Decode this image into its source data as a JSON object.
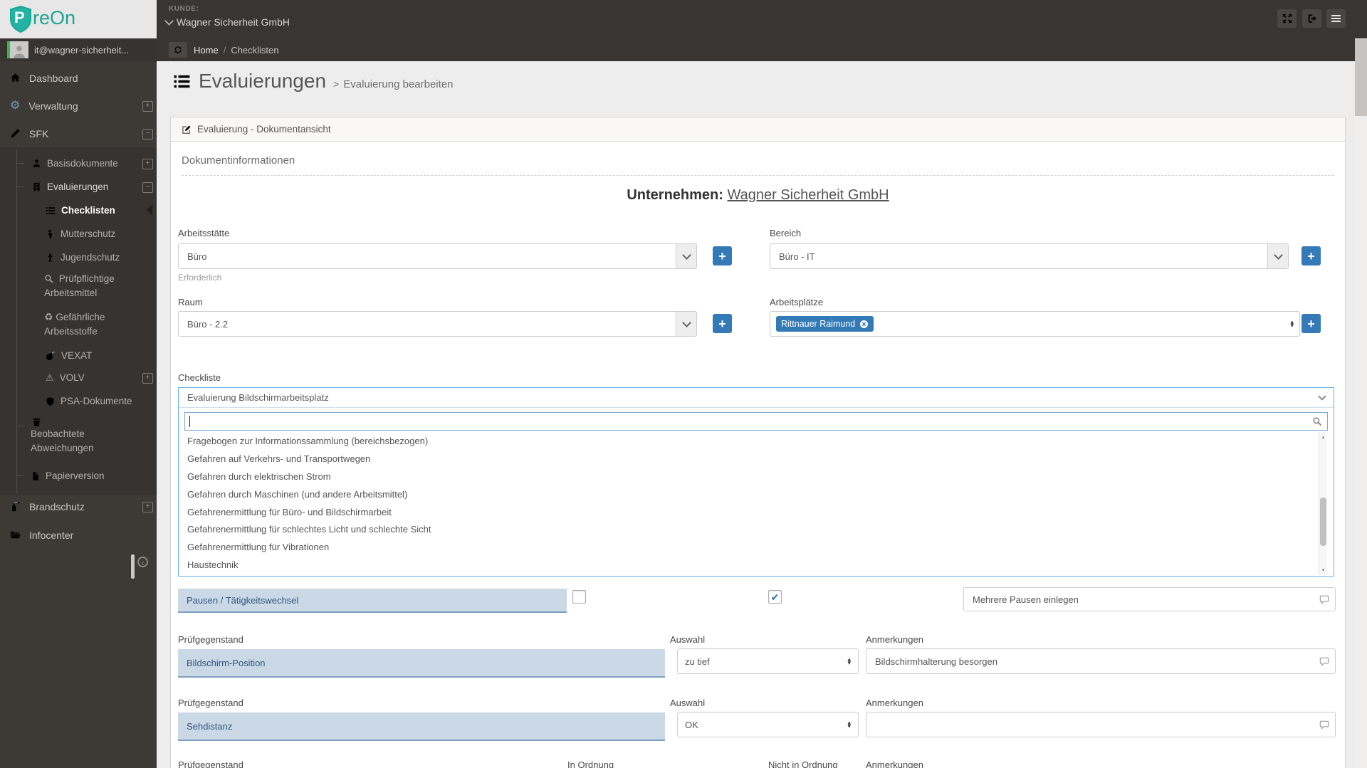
{
  "colors": {
    "accent_blue": "#337ab7",
    "brand_teal": "#23a393",
    "sidebar_bg": "#3a3633",
    "topbar_bg": "#393532",
    "highlight_row_bg": "#cbd9e7",
    "highlight_row_text": "#31567d",
    "focus_border": "#66afe9",
    "tag_green": "#3bb54a"
  },
  "brand": {
    "shield_letter": "P",
    "name_rest": "reOn"
  },
  "topbar": {
    "kunde_label": "KUNDE:",
    "kunde_value": "Wagner Sicherheit GmbH"
  },
  "user": {
    "email": "it@wagner-sicherheit..."
  },
  "breadcrumb": {
    "home": "Home",
    "separator": "/",
    "current": "Checklisten"
  },
  "sidebar": {
    "dashboard": "Dashboard",
    "verwaltung": "Verwaltung",
    "sfk": "SFK",
    "basisdokumente": "Basisdokumente",
    "evaluierungen": "Evaluierungen",
    "checklisten": "Checklisten",
    "mutterschutz": "Mutterschutz",
    "jugendschutz": "Jugendschutz",
    "pruefpflichtige": "Prüfpflichtige Arbeitsmittel",
    "gefaehrliche": "Gefährliche Arbeitsstoffe",
    "vexat": "VEXAT",
    "volv": "VOLV",
    "psa": "PSA-Dokumente",
    "beobachtete_line1": "Beobachtete",
    "beobachtete_line2": "Abweichungen",
    "papierversion": "Papierversion",
    "brandschutz": "Brandschutz",
    "infocenter": "Infocenter"
  },
  "page": {
    "title": "Evaluierungen",
    "title_separator": ">",
    "subtitle": "Evaluierung bearbeiten"
  },
  "panel": {
    "header": "Evaluierung - Dokumentansicht",
    "section": "Dokumentinformationen"
  },
  "company": {
    "label": "Unternehmen:",
    "name": "Wagner Sicherheit GmbH"
  },
  "form": {
    "arbeitsstaette": {
      "label": "Arbeitsstätte",
      "value": "Büro",
      "hint": "Erforderlich"
    },
    "bereich": {
      "label": "Bereich",
      "value": "Büro - IT"
    },
    "raum": {
      "label": "Raum",
      "value": "Büro - 2.2"
    },
    "arbeitsplaetze": {
      "label": "Arbeitsplätze",
      "tag": "Rittnauer Raimund"
    },
    "checkliste": {
      "label": "Checkliste",
      "selected": "Evaluierung Bildschirmarbeitsplatz",
      "search_value": "",
      "options": [
        "Fragebogen zur Informationssammlung (bereichsbezogen)",
        "Gefahren auf Verkehrs- und Transportwegen",
        "Gefahren durch elektrischen Strom",
        "Gefahren durch Maschinen (und andere Arbeitsmittel)",
        "Gefahrenermittlung für Büro- und Bildschirmarbeit",
        "Gefahrenermittlung für schlechtes Licht und schlechte Sicht",
        "Gefahrenermittlung für Vibrationen",
        "Haustechnik"
      ]
    }
  },
  "checklist_rows": {
    "labels": {
      "pruefgegenstand": "Prüfgegenstand",
      "auswahl": "Auswahl",
      "anmerkungen": "Anmerkungen",
      "in_ordnung": "In Ordnung",
      "nicht_in_ordnung": "Nicht in Ordnung"
    },
    "pausen": {
      "name": "Pausen / Tätigkeitswechsel",
      "ok_checked": false,
      "nok_checked": true,
      "anmerkung": "Mehrere Pausen einlegen"
    },
    "bildschirm_position": {
      "name": "Bildschirm-Position",
      "auswahl": "zu tief",
      "anmerkung": "Bildschirmhalterung besorgen"
    },
    "sehdistanz": {
      "name": "Sehdistanz",
      "auswahl": "OK",
      "anmerkung": ""
    }
  },
  "icons": {
    "gear": "⚙",
    "recycle": "♻",
    "warning": "⚠",
    "check": "✔",
    "plus": "+",
    "expand_plus": "+",
    "collapse_minus": "−",
    "spin_up": "▴",
    "spin_down": "▾",
    "back_arrow": "‹"
  }
}
